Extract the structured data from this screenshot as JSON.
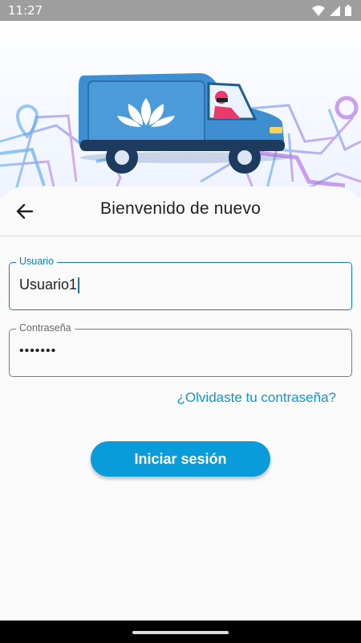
{
  "status_bar": {
    "time": "11:27"
  },
  "header": {
    "back_icon": "arrow-left-icon",
    "title": "Bienvenido de nuevo"
  },
  "form": {
    "username": {
      "label": "Usuario",
      "value": "Usuario1"
    },
    "password": {
      "label": "Contraseña",
      "value": "•••••••"
    },
    "forgot_link": "¿Olvidaste tu contraseña?",
    "login_button": "Iniciar sesión"
  },
  "colors": {
    "accent": "#0a9bda",
    "focus": "#0e7fb5",
    "link": "#1196cc",
    "van": "#3d8fd1"
  }
}
